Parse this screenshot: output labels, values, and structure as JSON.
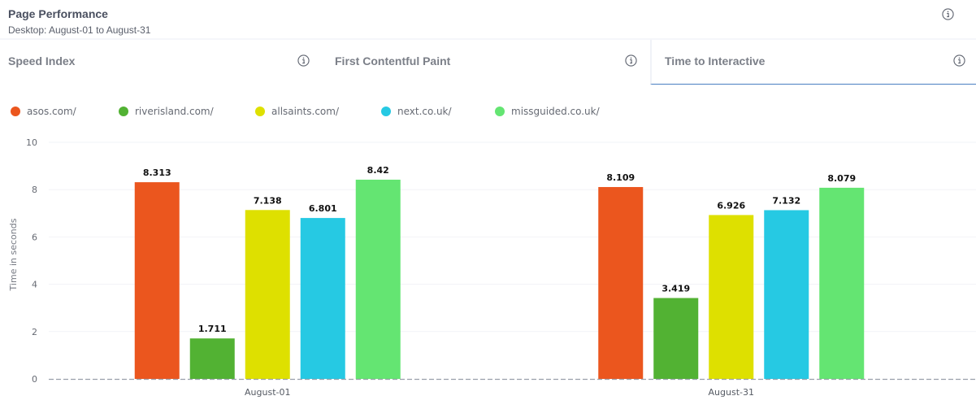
{
  "header": {
    "title": "Page Performance",
    "subtitle": "Desktop: August-01 to August-31",
    "info_icon": "info-circle-icon"
  },
  "tabs": [
    {
      "label": "Speed Index",
      "active": false,
      "icon": "info-circle-icon"
    },
    {
      "label": "First Contentful Paint",
      "active": false,
      "icon": "info-circle-icon"
    },
    {
      "label": "Time to Interactive",
      "active": true,
      "icon": "info-circle-icon"
    }
  ],
  "colors": {
    "active_tab_underline": "#4a7fc1"
  },
  "chart_data": {
    "type": "bar",
    "title": "",
    "xlabel": "",
    "ylabel": "Time in seconds",
    "ylim": [
      0,
      10
    ],
    "yticks": [
      0,
      2,
      4,
      6,
      8,
      10
    ],
    "grid": true,
    "legend_position": "top-left",
    "categories": [
      "August-01",
      "August-31"
    ],
    "series": [
      {
        "name": "asos.com/",
        "color": "#eb561e",
        "values": [
          8.313,
          8.109
        ]
      },
      {
        "name": "riverisland.com/",
        "color": "#52b233",
        "values": [
          1.711,
          3.419
        ]
      },
      {
        "name": "allsaints.com/",
        "color": "#dee000",
        "values": [
          7.138,
          6.926
        ]
      },
      {
        "name": "next.co.uk/",
        "color": "#26c9e3",
        "values": [
          6.801,
          7.132
        ]
      },
      {
        "name": "missguided.co.uk/",
        "color": "#64e572",
        "values": [
          8.42,
          8.079
        ]
      }
    ]
  }
}
